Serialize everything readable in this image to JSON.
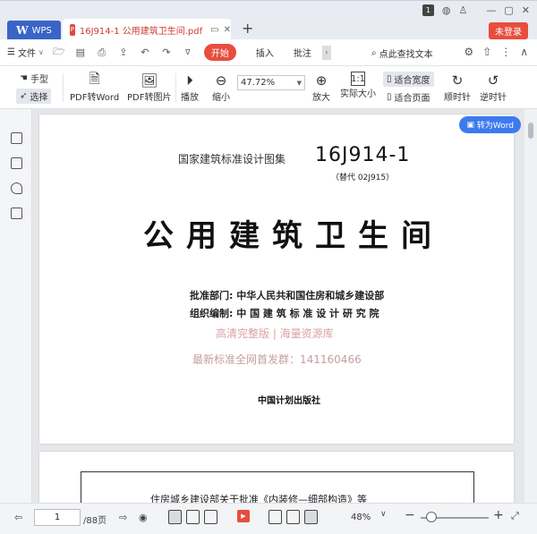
{
  "titlebar": {
    "app_tab": "WPS",
    "doc_tab_title": "16J914-1 公用建筑卫生间.pdf",
    "new_tab": "+",
    "badge": "1",
    "login_label": "未登录"
  },
  "menubar": {
    "file_label": "文件",
    "tabs": [
      "开始",
      "插入",
      "批注"
    ],
    "search_label": "点此查找文本"
  },
  "toolbar": {
    "hand_label": "手型",
    "select_label": "选择",
    "pdf_to_word": "PDF转Word",
    "pdf_to_image": "PDF转图片",
    "play": "播放",
    "zoom_out": "缩小",
    "zoom_value": "47.72%",
    "zoom_in": "放大",
    "actual_size": "实际大小",
    "fit_width": "适合宽度",
    "fit_page": "适合页面",
    "clockwise": "顺时针",
    "counterclockwise": "逆时针"
  },
  "document": {
    "to_word_button": "转为Word",
    "atlas_label": "国家建筑标准设计图集",
    "code": "16J914-1",
    "replaces": "（替代  02J915）",
    "title": "公用建筑卫生间",
    "approval_label": "批准部门:",
    "approval_value": "中华人民共和国住房和城乡建设部",
    "compiler_label": "组织编制:",
    "compiler_value": "中 国 建 筑 标 准 设 计 研 究 院",
    "watermark_1": "高清完整版 | 海量资源库",
    "watermark_2": "最新标准全网首发群：141160466",
    "publisher": "中国计划出版社",
    "page2_text": "住房城乡建设部关于批准《内装修—细部构造》等"
  },
  "statusbar": {
    "current_page": "1",
    "total_pages": "/88页",
    "zoom_percent": "48%",
    "zoom_slider_value": 0.16
  }
}
